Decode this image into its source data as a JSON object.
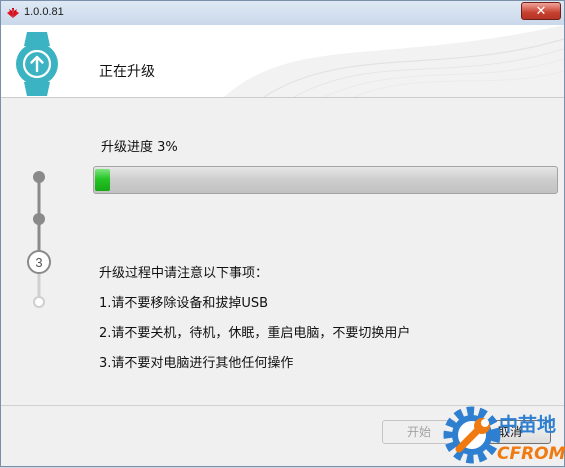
{
  "window": {
    "title": "1.0.0.81",
    "close_label": "✕"
  },
  "header": {
    "title": "正在升级"
  },
  "progress": {
    "label": "升级进度 3%",
    "value": 0.03
  },
  "notes": {
    "title": "升级过程中请注意以下事项：",
    "items": [
      "1.请不要移除设备和拔掉USB",
      "2.请不要关机，待机，休眠，重启电脑，不要切换用户",
      "3.请不要对电脑进行其他任何操作"
    ]
  },
  "steps": {
    "current_number": "3"
  },
  "buttons": {
    "start": "开始",
    "cancel": "取消"
  },
  "watermark": {
    "text_top": "中苗地",
    "text_bottom": "CFROM"
  },
  "colors": {
    "accent": "#3bb3c3",
    "progress": "#22c022",
    "close": "#c7402f"
  }
}
